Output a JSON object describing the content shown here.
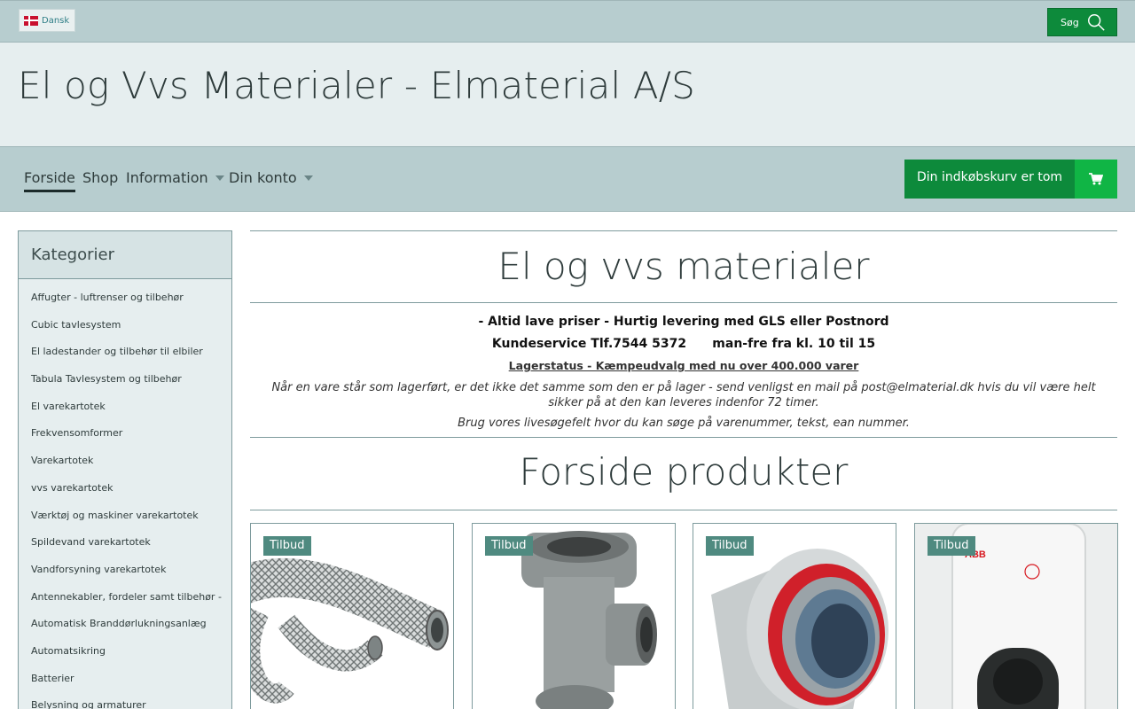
{
  "topbar": {
    "language_label": "Dansk",
    "search_label": "Søg"
  },
  "banner": {
    "site_title": "El og Vvs Materialer - Elmaterial A/S"
  },
  "nav": {
    "items": [
      {
        "label": "Forside"
      },
      {
        "label": "Shop"
      },
      {
        "label": "Information"
      },
      {
        "label": "Din konto"
      }
    ],
    "cart_label": "Din indkøbskurv er tom"
  },
  "sidebar": {
    "title": "Kategorier",
    "categories": [
      "Affugter - luftrenser og tilbehør",
      "Cubic tavlesystem",
      "El ladestander og tilbehør til elbiler",
      "Tabula Tavlesystem og tilbehør",
      "El varekartotek",
      "Frekvensomformer",
      "Varekartotek",
      "vvs varekartotek",
      "Værktøj og maskiner varekartotek",
      "Spildevand varekartotek",
      "Vandforsyning varekartotek",
      "Antennekabler, fordeler samt tilbehør -",
      "Automatisk Branddørlukningsanlæg",
      "Automatsikring",
      "Batterier",
      "Belysning og armaturer"
    ]
  },
  "main": {
    "heading": "El og vvs materialer",
    "tagline": "- Altid lave priser - Hurtig levering med GLS eller Postnord",
    "customer_service": "Kundeservice Tlf.7544 5372      man-fre fra kl. 10 til 15",
    "stock_link": "Lagerstatus  - Kæmpeudvalg med nu over 400.000 varer",
    "stock_note": "Når en vare står som lagerført, er det ikke det samme som den er på lager - send venligst en mail på post@elmaterial.dk hvis du vil være helt sikker på at den kan leveres indenfor 72 timer.",
    "search_note": "Brug vores livesøgefelt hvor du kan søge på varenummer, tekst, ean nummer.",
    "products_heading": "Forside produkter",
    "products": [
      {
        "badge": "Tilbud",
        "image": "braided-hose"
      },
      {
        "badge": "Tilbud",
        "image": "galvanized-tee-fitting"
      },
      {
        "badge": "Tilbud",
        "image": "press-fitting-red-ring"
      },
      {
        "badge": "Tilbud",
        "image": "abb-ev-charger"
      }
    ]
  },
  "colors": {
    "topbar_bg": "#b7cdcf",
    "banner_bg": "#e6eeef",
    "accent_green": "#0d8a3b",
    "accent_green_light": "#10b545",
    "badge_bg": "#4f8a80"
  }
}
